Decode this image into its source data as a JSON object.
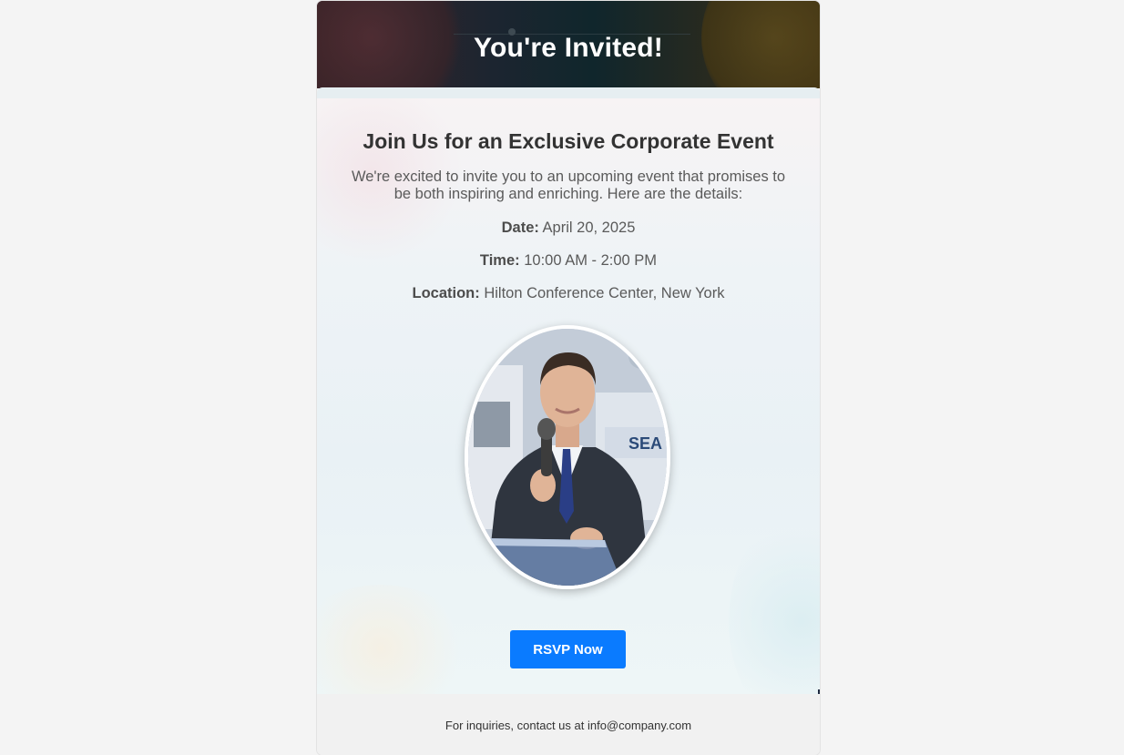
{
  "header": {
    "title": "You're Invited!"
  },
  "event": {
    "heading": "Join Us for an Exclusive Corporate Event",
    "intro": "We're excited to invite you to an upcoming event that promises to be both inspiring and enriching. Here are the details:",
    "date_label": "Date:",
    "date_value": " April 20, 2025",
    "time_label": "Time:",
    "time_value": " 10:00 AM - 2:00 PM",
    "location_label": "Location:",
    "location_value": " Hilton Conference Center, New York"
  },
  "photo": {
    "icon": "speaker-photo",
    "sign_text": "SEA"
  },
  "cta": {
    "label": "RSVP Now",
    "color": "#0a7bff"
  },
  "footer": {
    "text": "For inquiries, contact us at info@company.com"
  }
}
